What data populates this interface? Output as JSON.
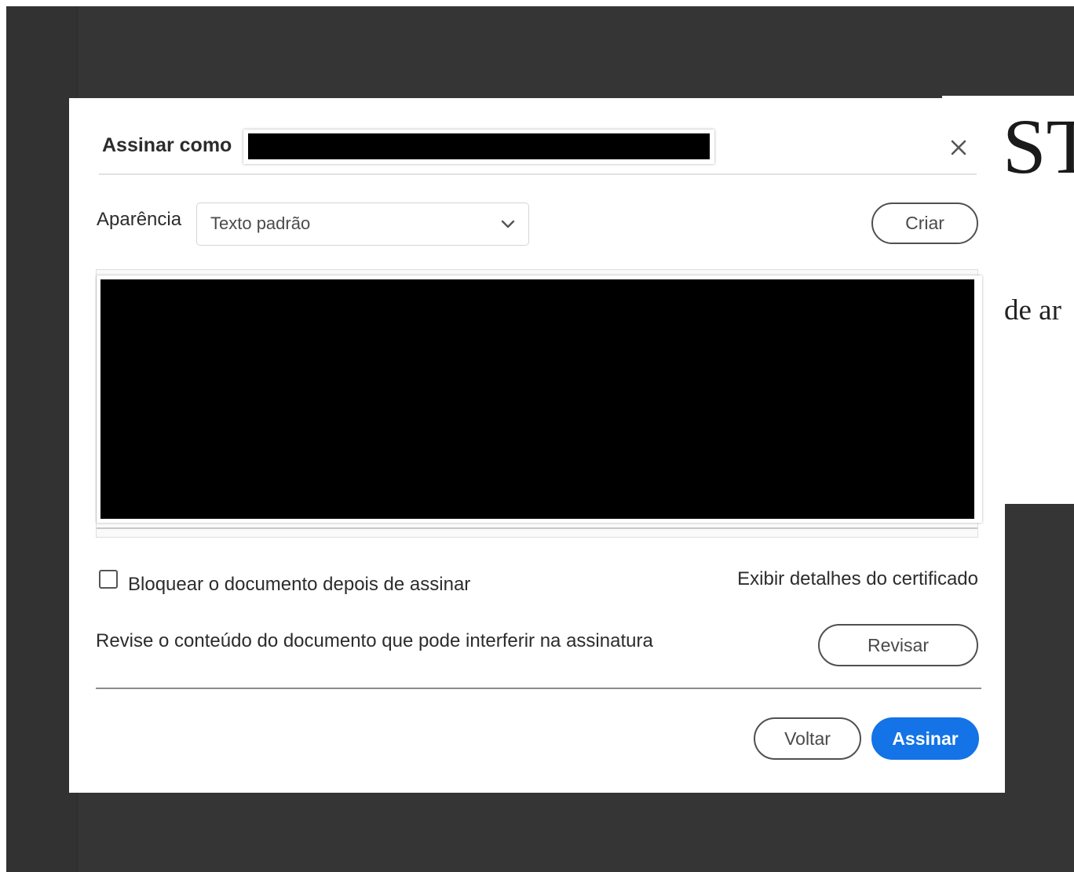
{
  "background_document": {
    "heading_fragment": "ST",
    "body_fragment": "de ar"
  },
  "dialog": {
    "title_prefix": "Assinar como",
    "close_icon": "close-icon",
    "appearance": {
      "label": "Aparência",
      "selected": "Texto padrão",
      "create_label": "Criar"
    },
    "lock_document": {
      "label": "Bloquear o documento depois de assinar",
      "checked": false
    },
    "certificate_link": "Exibir detalhes do certificado",
    "review": {
      "text": "Revise o conteúdo do documento que pode interferir na assinatura",
      "button_label": "Revisar"
    },
    "footer": {
      "back_label": "Voltar",
      "sign_label": "Assinar"
    }
  },
  "colors": {
    "accent": "#1473e6",
    "app_background": "#353535",
    "redaction": "#000000"
  }
}
